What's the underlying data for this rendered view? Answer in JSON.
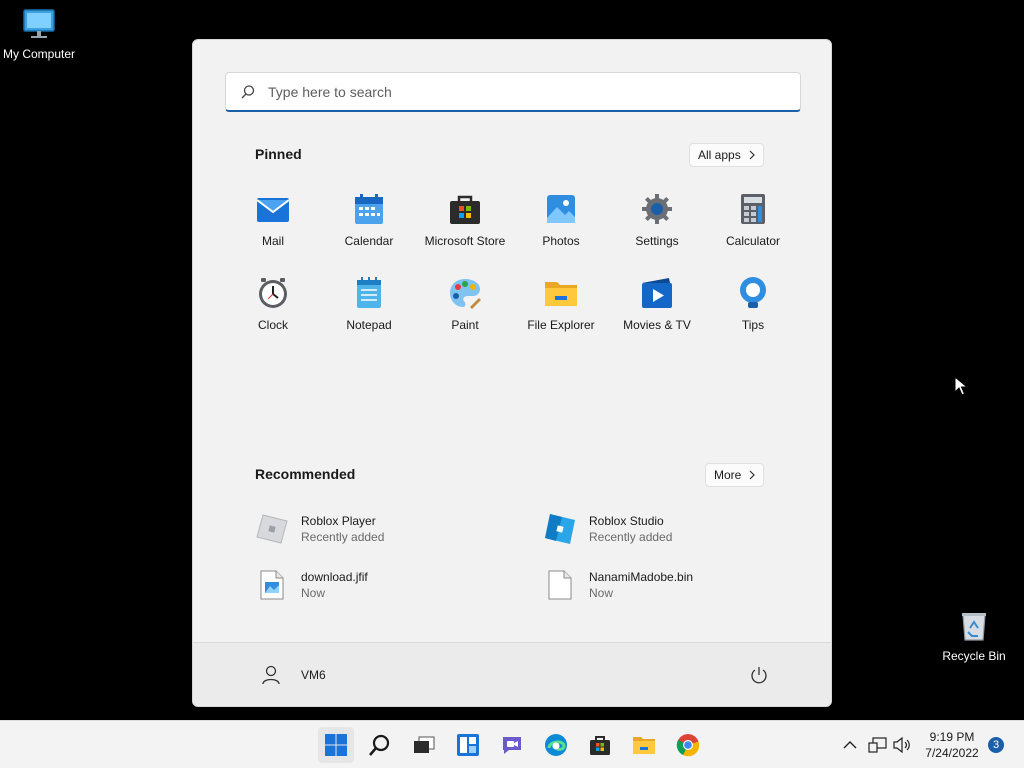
{
  "desktop": {
    "icons": [
      {
        "label": "My Computer",
        "icon": "monitor-icon"
      },
      {
        "label": "Recycle Bin",
        "icon": "recycle-bin-icon"
      }
    ]
  },
  "start_menu": {
    "search_placeholder": "Type here to search",
    "pinned_title": "Pinned",
    "all_apps_label": "All apps",
    "pinned_apps": [
      {
        "label": "Mail",
        "icon": "mail-icon"
      },
      {
        "label": "Calendar",
        "icon": "calendar-icon"
      },
      {
        "label": "Microsoft Store",
        "icon": "store-icon"
      },
      {
        "label": "Photos",
        "icon": "photos-icon"
      },
      {
        "label": "Settings",
        "icon": "settings-icon"
      },
      {
        "label": "Calculator",
        "icon": "calculator-icon"
      },
      {
        "label": "Clock",
        "icon": "clock-icon"
      },
      {
        "label": "Notepad",
        "icon": "notepad-icon"
      },
      {
        "label": "Paint",
        "icon": "paint-icon"
      },
      {
        "label": "File Explorer",
        "icon": "folder-icon"
      },
      {
        "label": "Movies & TV",
        "icon": "movies-icon"
      },
      {
        "label": "Tips",
        "icon": "tips-icon"
      }
    ],
    "recommended_title": "Recommended",
    "more_label": "More",
    "recommended": [
      {
        "name": "Roblox Player",
        "sub": "Recently added",
        "icon": "roblox-player-icon"
      },
      {
        "name": "Roblox Studio",
        "sub": "Recently added",
        "icon": "roblox-studio-icon"
      },
      {
        "name": "download.jfif",
        "sub": "Now",
        "icon": "image-file-icon"
      },
      {
        "name": "NanamiMadobe.bin",
        "sub": "Now",
        "icon": "file-icon"
      }
    ],
    "user_name": "VM6"
  },
  "taskbar": {
    "time": "9:19 PM",
    "date": "7/24/2022",
    "notification_count": "3"
  },
  "colors": {
    "accent": "#1a5fa8",
    "menu_bg": "#f2f2f2",
    "taskbar_bg": "#f3f3f3"
  }
}
